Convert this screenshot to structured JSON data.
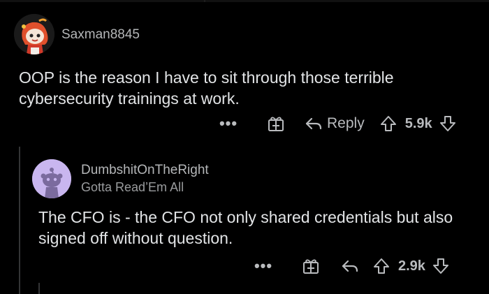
{
  "colors": {
    "background": "#000000",
    "text": "#e2e4e6",
    "muted": "#b9bbbe",
    "thread_line": "#343536",
    "avatar2_bg": "#c9b6ef"
  },
  "comment": {
    "username": "Saxman8845",
    "avatar_icon": "snoo-avatar-red-hair-icon",
    "body": "OOP is the reason I have to sit through those terrible cybersecurity trainings at work.",
    "actions": {
      "more": "•••",
      "reply_label": "Reply",
      "votes": "5.9k"
    }
  },
  "reply": {
    "username": "DumbshitOnTheRight",
    "flair": "Gotta Read’Em All",
    "avatar_icon": "default-snoo-avatar-icon",
    "body": "The CFO is - the CFO not only shared credentials but also signed off without question.",
    "actions": {
      "more": "•••",
      "votes": "2.9k"
    }
  }
}
